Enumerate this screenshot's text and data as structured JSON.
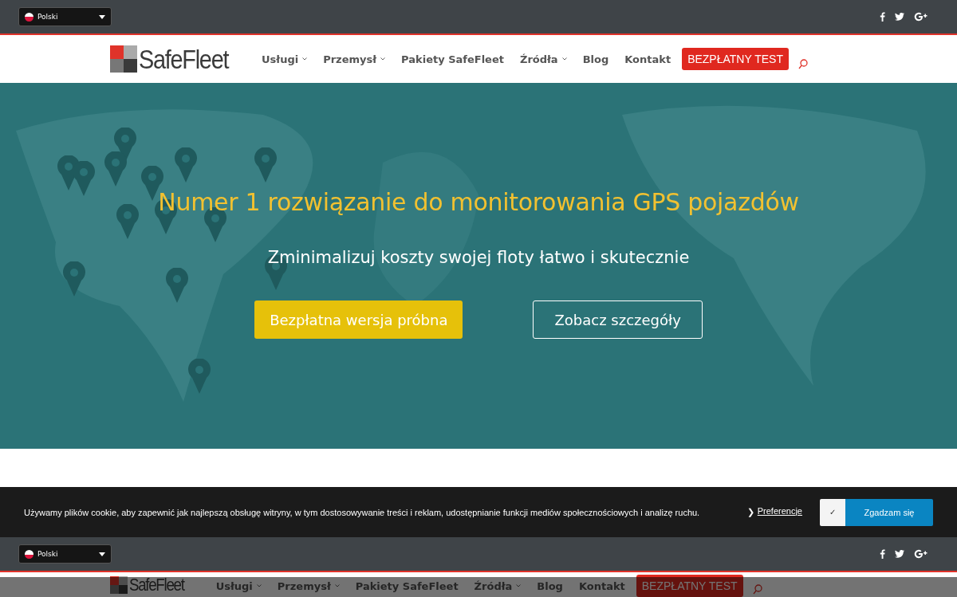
{
  "top_bar": {
    "language": "Polski"
  },
  "header": {
    "logo": "SafeFleet",
    "nav": [
      {
        "label": "Usługi",
        "dropdown": true
      },
      {
        "label": "Przemysł",
        "dropdown": true
      },
      {
        "label": "Pakiety SafeFleet",
        "dropdown": false
      },
      {
        "label": "Źródła",
        "dropdown": true
      },
      {
        "label": "Blog",
        "dropdown": false
      },
      {
        "label": "Kontakt",
        "dropdown": false
      }
    ],
    "cta": "BEZPŁATNY TEST"
  },
  "hero": {
    "title": "Numer 1 rozwiązanie do monitorowania GPS pojazdów",
    "subtitle": "Zminimalizuj koszty swojej floty łatwo i skutecznie",
    "primary_button": "Bezpłatna wersja próbna",
    "secondary_button": "Zobacz szczegóły"
  },
  "cookie_bar": {
    "text": "Używamy plików cookie, aby zapewnić jak najlepszą obsługę witryny, w tym dostosowywanie treści i reklam, udostępnianie funkcji mediów społecznościowych i analizę ruchu.",
    "chevron": "❯",
    "preferences": "Preferencje",
    "check": "✓",
    "checked": true,
    "accept": "Zgadzam się"
  },
  "sticky_top_bar": {
    "language": "Polski"
  },
  "sticky_header": {
    "logo": "SafeFleet",
    "nav": [
      {
        "label": "Usługi",
        "dropdown": true
      },
      {
        "label": "Przemysł",
        "dropdown": true
      },
      {
        "label": "Pakiety SafeFleet",
        "dropdown": false
      },
      {
        "label": "Źródła",
        "dropdown": true
      },
      {
        "label": "Blog",
        "dropdown": false
      },
      {
        "label": "Kontakt",
        "dropdown": false
      }
    ],
    "cta": "BEZPŁATNY TEST"
  }
}
